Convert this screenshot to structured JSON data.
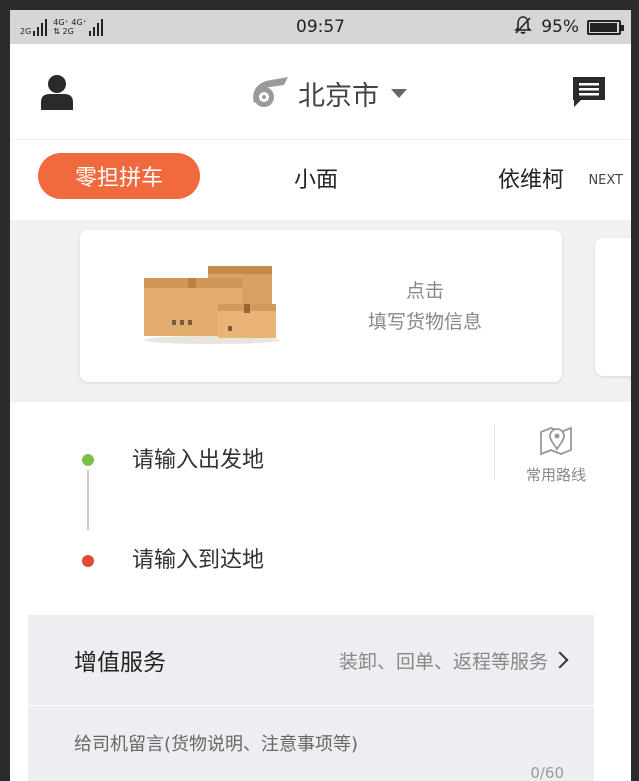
{
  "status_bar": {
    "network_left": "2G",
    "network_mid_top": "4G⁺ 4G⁺",
    "network_mid_bottom": "⇅ 2G",
    "time": "09:57",
    "battery_percent": "95%",
    "battery_level": 0.95
  },
  "header": {
    "city": "北京市"
  },
  "tabs": {
    "active": "零担拼车",
    "items": [
      "小面",
      "依维柯"
    ],
    "next_label": "NEXT"
  },
  "cargo_card": {
    "line1": "点击",
    "line2": "填写货物信息"
  },
  "route": {
    "origin_placeholder": "请输入出发地",
    "destination_placeholder": "请输入到达地",
    "common_routes_label": "常用路线"
  },
  "services": {
    "title": "增值服务",
    "hint": "装卸、回单、返程等服务"
  },
  "driver_message": {
    "placeholder": "给司机留言(货物说明、注意事项等)",
    "counter": "0/60"
  },
  "colors": {
    "accent": "#f06a3d",
    "origin_dot": "#7cc04b",
    "destination_dot": "#e04a32",
    "status_bar_bg": "#d6d6d6"
  }
}
